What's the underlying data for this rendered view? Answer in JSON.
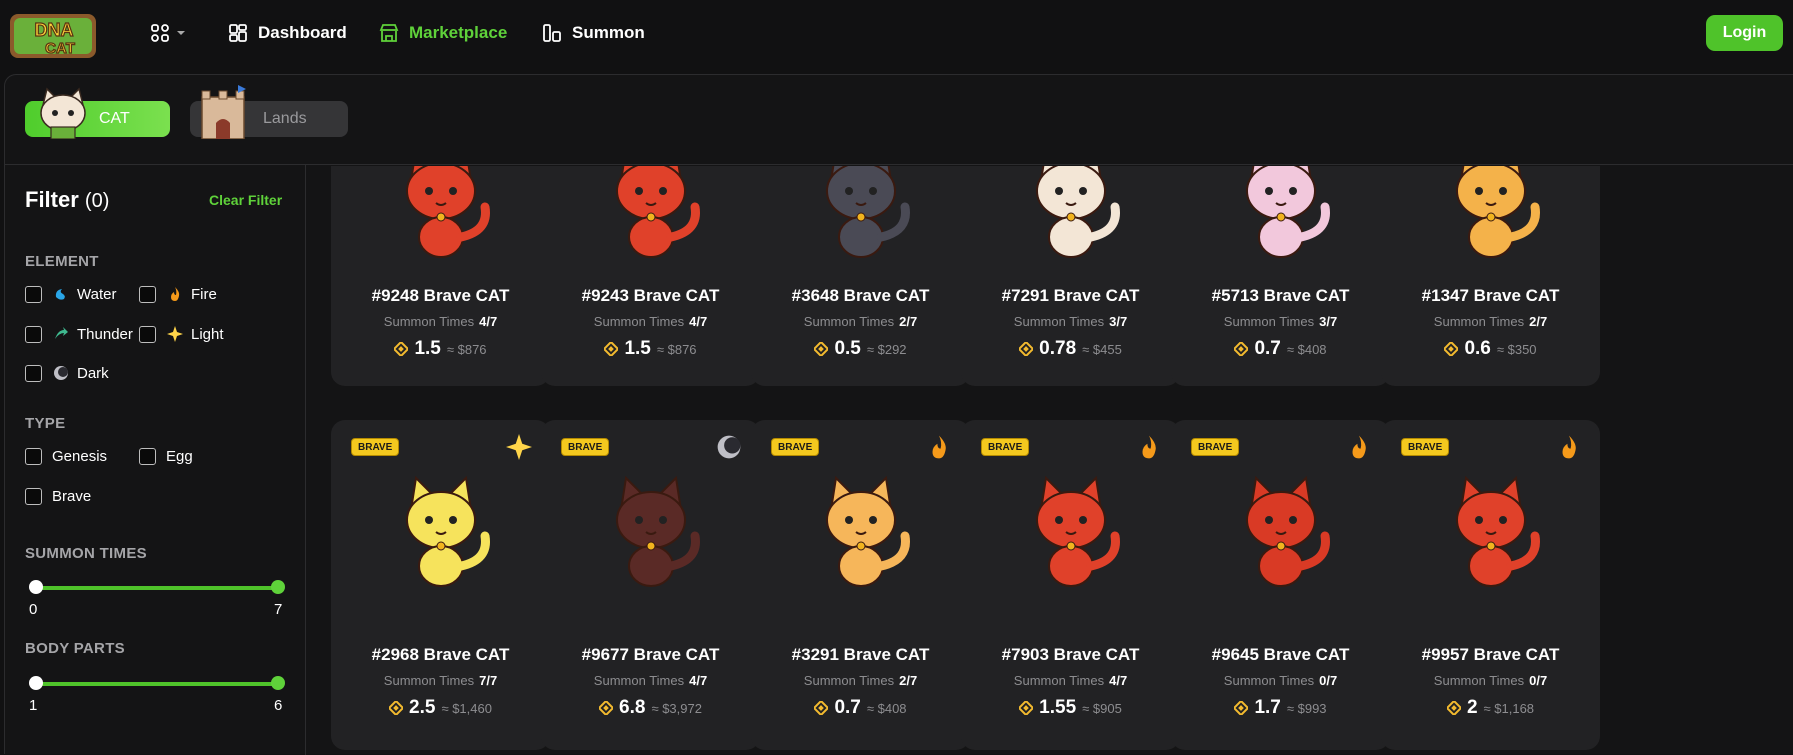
{
  "nav": {
    "logo_top": "DNA",
    "logo_bottom": "CAT",
    "items": [
      {
        "label": "Dashboard"
      },
      {
        "label": "Marketplace"
      },
      {
        "label": "Summon"
      }
    ],
    "login_label": "Login",
    "active": "Marketplace",
    "accent_color": "#5fd23a"
  },
  "tabs": [
    {
      "label": "CAT",
      "active": true
    },
    {
      "label": "Lands",
      "active": false
    }
  ],
  "filter": {
    "title": "Filter",
    "count": "(0)",
    "clear_label": "Clear Filter",
    "element_title": "ELEMENT",
    "elements": [
      {
        "label": "Water",
        "icon": "water-icon"
      },
      {
        "label": "Fire",
        "icon": "fire-icon"
      },
      {
        "label": "Thunder",
        "icon": "thunder-icon"
      },
      {
        "label": "Light",
        "icon": "light-icon"
      },
      {
        "label": "Dark",
        "icon": "dark-icon"
      }
    ],
    "type_title": "TYPE",
    "types": [
      {
        "label": "Genesis"
      },
      {
        "label": "Egg"
      },
      {
        "label": "Brave"
      }
    ],
    "summon_title": "SUMMON TIMES",
    "summon_min": "0",
    "summon_max": "7",
    "body_title": "BODY PARTS",
    "body_min": "1",
    "body_max": "6"
  },
  "summon_label": "Summon Times",
  "cards_row1": [
    {
      "name": "#9248 Brave CAT",
      "summon": "4/7",
      "price": "1.5",
      "usd": "≈ $876",
      "color": "#e0412a"
    },
    {
      "name": "#9243 Brave CAT",
      "summon": "4/7",
      "price": "1.5",
      "usd": "≈ $876",
      "color": "#e0412a"
    },
    {
      "name": "#3648 Brave CAT",
      "summon": "2/7",
      "price": "0.5",
      "usd": "≈ $292",
      "color": "#4a4a55"
    },
    {
      "name": "#7291 Brave CAT",
      "summon": "3/7",
      "price": "0.78",
      "usd": "≈ $455",
      "color": "#f3e6d6"
    },
    {
      "name": "#5713 Brave CAT",
      "summon": "3/7",
      "price": "0.7",
      "usd": "≈ $408",
      "color": "#f2c8dc"
    },
    {
      "name": "#1347 Brave CAT",
      "summon": "2/7",
      "price": "0.6",
      "usd": "≈ $350",
      "color": "#f4b24a"
    }
  ],
  "cards_row2": [
    {
      "name": "#2968 Brave CAT",
      "summon": "7/7",
      "price": "2.5",
      "usd": "≈ $1,460",
      "badge": "BRAVE",
      "element": "light-icon",
      "color": "#f6e35c"
    },
    {
      "name": "#9677 Brave CAT",
      "summon": "4/7",
      "price": "6.8",
      "usd": "≈ $3,972",
      "badge": "BRAVE",
      "element": "dark-icon",
      "color": "#5a2a26"
    },
    {
      "name": "#3291 Brave CAT",
      "summon": "2/7",
      "price": "0.7",
      "usd": "≈ $408",
      "badge": "BRAVE",
      "element": "fire-icon",
      "color": "#f6b65a"
    },
    {
      "name": "#7903 Brave CAT",
      "summon": "4/7",
      "price": "1.55",
      "usd": "≈ $905",
      "badge": "BRAVE",
      "element": "fire-icon",
      "color": "#e0412a"
    },
    {
      "name": "#9645 Brave CAT",
      "summon": "0/7",
      "price": "1.7",
      "usd": "≈ $993",
      "badge": "BRAVE",
      "element": "fire-icon",
      "color": "#d93a25"
    },
    {
      "name": "#9957 Brave CAT",
      "summon": "0/7",
      "price": "2",
      "usd": "≈ $1,168",
      "badge": "BRAVE",
      "element": "fire-icon",
      "color": "#e0412a"
    }
  ]
}
